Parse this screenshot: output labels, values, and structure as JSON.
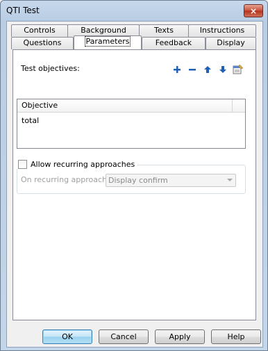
{
  "window": {
    "title": "QTI Test",
    "close_glyph": "×"
  },
  "tabs": {
    "back_row": [
      "Controls",
      "Background",
      "Texts",
      "Instructions"
    ],
    "front_row": [
      "Questions",
      "Parameters",
      "Feedback",
      "Display"
    ],
    "active": "Parameters"
  },
  "objectives": {
    "label": "Test objectives:",
    "toolbar": [
      "add-icon",
      "remove-icon",
      "move-up-icon",
      "move-down-icon",
      "properties-icon"
    ],
    "column_header": "Objective",
    "rows": [
      "total"
    ]
  },
  "recurring": {
    "checkbox_label": "Allow recurring approaches",
    "checked": false,
    "on_label": "On recurring approach:",
    "selected": "Display confirm"
  },
  "buttons": {
    "ok": "OK",
    "cancel": "Cancel",
    "apply": "Apply",
    "help": "Help"
  },
  "colors": {
    "accent": "#1f5fb5",
    "disabled": "#a0a0a0"
  }
}
